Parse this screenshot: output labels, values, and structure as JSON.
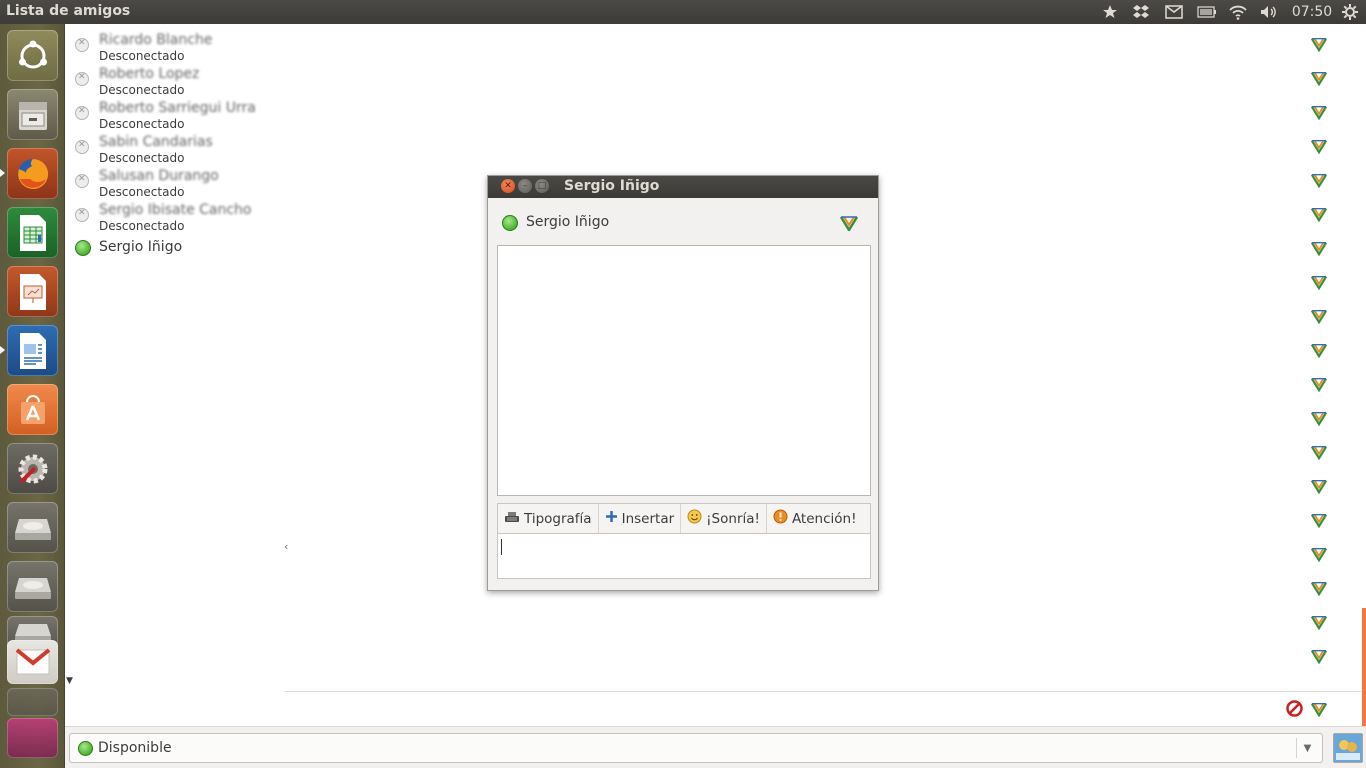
{
  "top_panel": {
    "title": "Lista de amigos",
    "clock": "07:50",
    "tray_icons": [
      "bookmark-star-icon",
      "dropbox-icon",
      "mail-icon",
      "battery-icon",
      "wifi-icon",
      "volume-icon",
      "settings-gear-icon"
    ]
  },
  "launcher": {
    "items": [
      "ubuntu-dash",
      "files",
      "firefox",
      "libreoffice-calc",
      "libreoffice-impress",
      "libreoffice-writer",
      "software-center",
      "system-settings",
      "drive-1",
      "drive-2",
      "cd-rom",
      "gmail"
    ]
  },
  "buddy_list": {
    "items": [
      {
        "name": "Ricardo Blanche",
        "status": "Desconectado",
        "online": false,
        "blurred": true
      },
      {
        "name": "Roberto Lopez",
        "status": "Desconectado",
        "online": false,
        "blurred": true
      },
      {
        "name": "Roberto Sarriegui Urra",
        "status": "Desconectado",
        "online": false,
        "blurred": true
      },
      {
        "name": "Sabin Candarias",
        "status": "Desconectado",
        "online": false,
        "blurred": true
      },
      {
        "name": "Salusan Durango",
        "status": "Desconectado",
        "online": false,
        "blurred": true
      },
      {
        "name": "Sergio Ibisate Cancho",
        "status": "Desconectado",
        "online": false,
        "blurred": true
      },
      {
        "name": "Sergio Iñigo",
        "status": "",
        "online": true,
        "blurred": false
      }
    ]
  },
  "chat": {
    "window_title": "Sergio Iñigo",
    "contact_name": "Sergio Iñigo",
    "toolbar": {
      "font": "Tipografía",
      "insert": "Insertar",
      "smile": "¡Sonría!",
      "attention": "Atención!"
    }
  },
  "status_bar": {
    "status": "Disponible"
  },
  "colors": {
    "online": "#4bb32f",
    "panel": "#3c3b37",
    "accent": "#f07746"
  }
}
